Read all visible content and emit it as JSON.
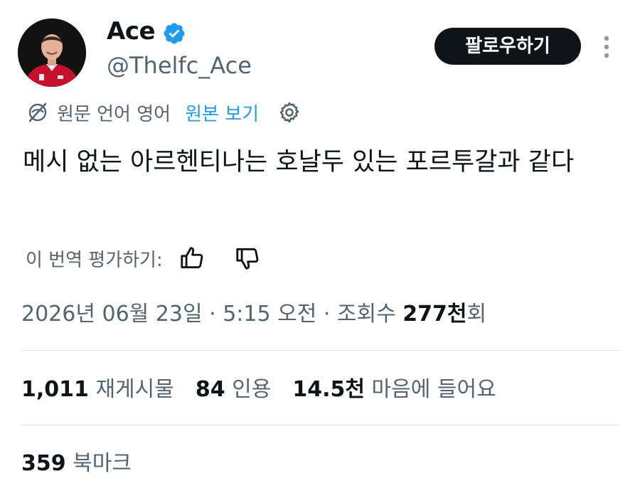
{
  "author": {
    "display_name": "Ace",
    "handle": "@Thelfc_Ace",
    "verified": true
  },
  "follow_label": "팔로우하기",
  "translation": {
    "original_language": "원문 언어 영어",
    "view_original": "원본 보기"
  },
  "tweet": {
    "text": "메시 없는 아르헨티나는 호날두 있는 포르투갈과 같다"
  },
  "rate_translation_label": "이 번역 평가하기:",
  "meta": {
    "date": "2026년 06월 23일",
    "separator": " · ",
    "time": "5:15 오전",
    "views_label": "조회수",
    "views_count": "277천",
    "views_suffix": "회"
  },
  "stats": {
    "reposts": {
      "count": "1,011",
      "label": "재게시물"
    },
    "quotes": {
      "count": "84",
      "label": "인용"
    },
    "likes": {
      "count": "14.5천",
      "label": "마음에 들어요"
    },
    "bookmarks": {
      "count": "359",
      "label": "북마크"
    }
  },
  "colors": {
    "accent": "#1d9bf0",
    "text_primary": "#0f1419",
    "text_secondary": "#536471",
    "divider": "#e1e6ea",
    "avatar_jersey": "#c8102e"
  },
  "icons": {
    "verified": "verified-badge-icon",
    "more": "more-vertical-icon",
    "translate": "globe-off-icon",
    "settings": "gear-icon",
    "rate_up": "thumbs-up-icon",
    "rate_down": "thumbs-down-icon"
  }
}
